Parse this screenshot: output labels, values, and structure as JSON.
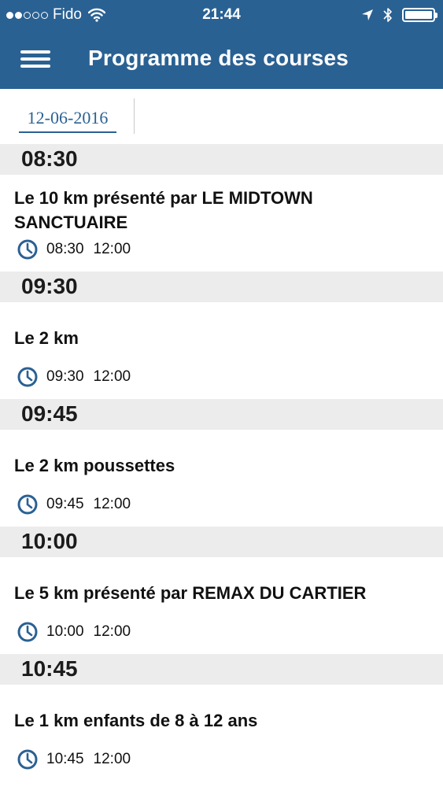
{
  "status_bar": {
    "carrier": "Fido",
    "time": "21:44"
  },
  "header": {
    "title": "Programme des courses",
    "menu_icon": "hamburger-menu-icon"
  },
  "date_tabs": {
    "selected": "12-06-2016"
  },
  "theme": {
    "primary": "#2a6193",
    "section_bg": "#ececec"
  },
  "sections": [
    {
      "time": "08:30",
      "race": {
        "title": "Le 10 km présenté par LE MIDTOWN SANCTUAIRE",
        "start": "08:30",
        "end": "12:00"
      }
    },
    {
      "time": "09:30",
      "race": {
        "title": "Le 2 km",
        "start": "09:30",
        "end": "12:00"
      }
    },
    {
      "time": "09:45",
      "race": {
        "title": "Le 2 km poussettes",
        "start": "09:45",
        "end": "12:00"
      }
    },
    {
      "time": "10:00",
      "race": {
        "title": "Le 5 km présenté par REMAX DU CARTIER",
        "start": "10:00",
        "end": "12:00"
      }
    },
    {
      "time": "10:45",
      "race": {
        "title": "Le 1 km enfants de 8 à 12 ans",
        "start": "10:45",
        "end": "12:00"
      }
    }
  ]
}
